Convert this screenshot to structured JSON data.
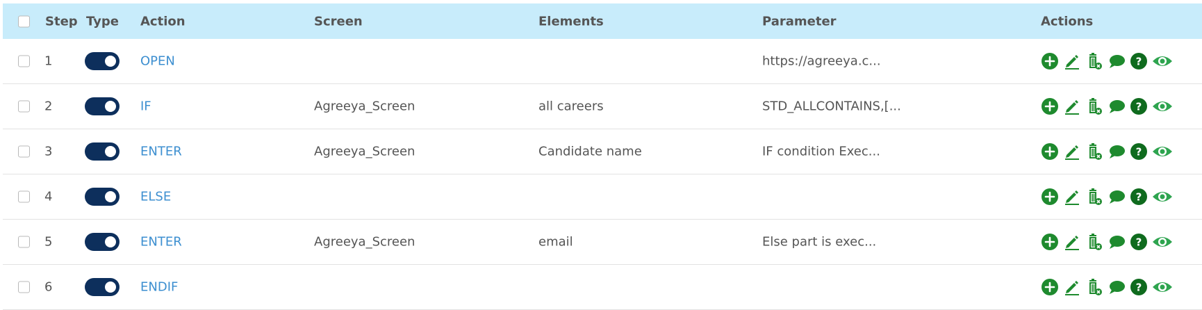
{
  "header": {
    "step": "Step",
    "type": "Type",
    "action": "Action",
    "screen": "Screen",
    "elements": "Elements",
    "parameter": "Parameter",
    "actions": "Actions"
  },
  "rows": [
    {
      "step": "1",
      "action": "OPEN",
      "screen": "",
      "elements": "",
      "parameter": "https://agreeya.c..."
    },
    {
      "step": "2",
      "action": "IF",
      "screen": "Agreeya_Screen",
      "elements": "all careers",
      "parameter": "STD_ALLCONTAINS,[..."
    },
    {
      "step": "3",
      "action": "ENTER",
      "screen": "Agreeya_Screen",
      "elements": "Candidate name",
      "parameter": "IF condition Exec..."
    },
    {
      "step": "4",
      "action": "ELSE",
      "screen": "",
      "elements": "",
      "parameter": ""
    },
    {
      "step": "5",
      "action": "ENTER",
      "screen": "Agreeya_Screen",
      "elements": "email",
      "parameter": "Else part is exec..."
    },
    {
      "step": "6",
      "action": "ENDIF",
      "screen": "",
      "elements": "",
      "parameter": ""
    }
  ],
  "colors": {
    "header_bg": "#c8ecfb",
    "toggle_on": "#0d2f5c",
    "action_link": "#3d8fd0",
    "icon_green": "#1e8a2e",
    "help_green": "#0f6b1e"
  },
  "row_icons": [
    "add-icon",
    "edit-icon",
    "delete-icon",
    "comment-icon",
    "help-icon",
    "view-icon"
  ]
}
